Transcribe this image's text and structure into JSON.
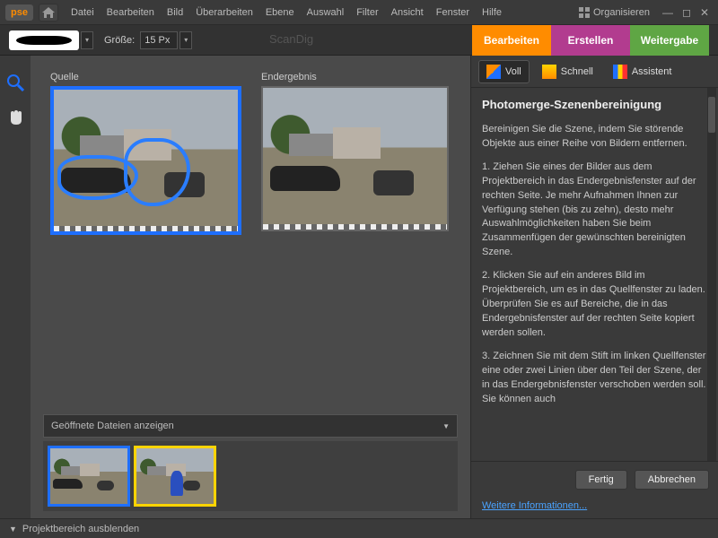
{
  "app": {
    "logo": "pse"
  },
  "menu": {
    "items": [
      "Datei",
      "Bearbeiten",
      "Bild",
      "Überarbeiten",
      "Ebene",
      "Auswahl",
      "Filter",
      "Ansicht",
      "Fenster",
      "Hilfe"
    ],
    "organize": "Organisieren"
  },
  "options": {
    "size_label": "Größe:",
    "size_value": "15 Px",
    "watermark": "ScanDig"
  },
  "modes": {
    "edit": "Bearbeiten",
    "create": "Erstellen",
    "share": "Weitergabe"
  },
  "canvas": {
    "source_label": "Quelle",
    "result_label": "Endergebnis"
  },
  "project": {
    "dropdown": "Geöffnete Dateien anzeigen"
  },
  "right": {
    "tabs": {
      "full": "Voll",
      "quick": "Schnell",
      "guided": "Assistent"
    },
    "title": "Photomerge-Szenenbereinigung",
    "intro": "Bereinigen Sie die Szene, indem Sie störende Objekte aus einer Reihe von Bildern entfernen.",
    "step1": "1. Ziehen Sie eines der Bilder aus dem Projektbereich in das Endergebnisfenster auf der rechten Seite. Je mehr Aufnahmen Ihnen zur Verfügung stehen (bis zu zehn), desto mehr Auswahlmöglichkeiten haben Sie beim Zusammenfügen der gewünschten bereinigten Szene.",
    "step2": "2. Klicken Sie auf ein anderes Bild im Projektbereich, um es in das Quellfenster zu laden. Überprüfen Sie es auf Bereiche, die in das Endergebnisfenster auf der rechten Seite kopiert werden sollen.",
    "step3": "3. Zeichnen Sie mit dem Stift im linken Quellfenster eine oder zwei Linien über den Teil der Szene, der in das Endergebnisfenster verschoben werden soll. Sie können auch",
    "done": "Fertig",
    "cancel": "Abbrechen",
    "more_info": "Weitere Informationen..."
  },
  "footer": {
    "hide_project": "Projektbereich ausblenden"
  }
}
